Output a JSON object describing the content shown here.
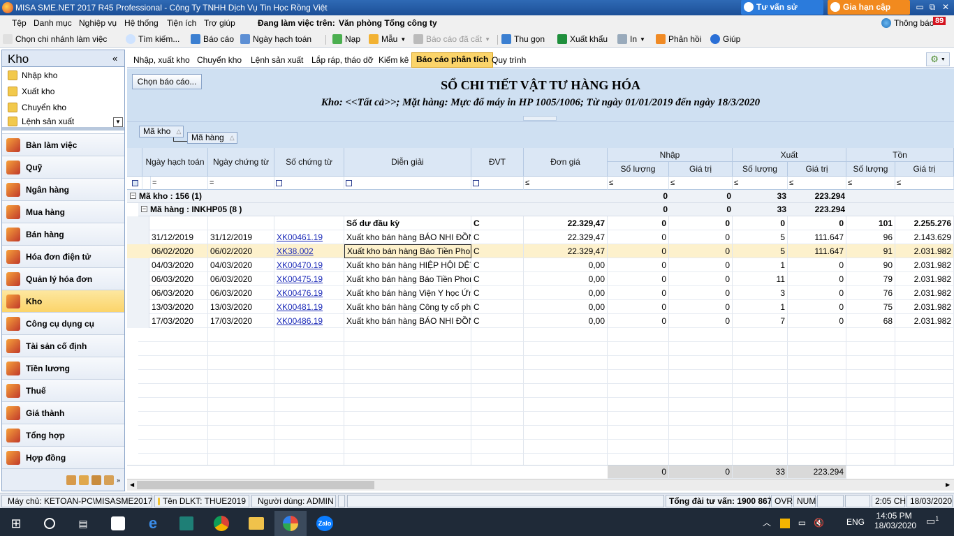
{
  "window": {
    "title": "MISA SME.NET 2017 R45 Professional - Công Ty TNHH Dịch Vụ Tin Học Rồng Việt",
    "advice": "Tư vấn sử dụng",
    "renew": "Gia hạn cập nhật",
    "minimize": "▭",
    "restore": "⧉",
    "close": "✕"
  },
  "menu": {
    "items": [
      "Tệp",
      "Danh mục",
      "Nghiệp vụ",
      "Hệ thống",
      "Tiện ích",
      "Trợ giúp"
    ],
    "working_label": "Đang làm việc trên:",
    "working_value": "Văn phòng Tổng công ty",
    "notice_label": "Thông báo",
    "notice_count": "89"
  },
  "toolbar": {
    "items": [
      "Chọn chi nhánh làm việc",
      "Tìm kiếm...",
      "Báo cáo",
      "Ngày hạch toán",
      "Nạp",
      "Mẫu",
      "Báo cáo đã cất",
      "Thu gọn",
      "Xuất khẩu",
      "In",
      "Phản hồi",
      "Giúp"
    ]
  },
  "sidebar": {
    "title": "Kho",
    "collapse": "«",
    "links": [
      "Nhập kho",
      "Xuất kho",
      "Chuyển kho",
      "Lệnh sản xuất"
    ],
    "modules": [
      "Bàn làm việc",
      "Quỹ",
      "Ngân hàng",
      "Mua hàng",
      "Bán hàng",
      "Hóa đơn điện tử",
      "Quản lý hóa đơn",
      "Kho",
      "Công cụ dụng cụ",
      "Tài sản cố định",
      "Tiền lương",
      "Thuế",
      "Giá thành",
      "Tổng hợp",
      "Hợp đồng"
    ]
  },
  "tabs": [
    "Nhập, xuất kho",
    "Chuyển kho",
    "Lệnh sản xuất",
    "Lắp ráp, tháo dỡ",
    "Kiểm kê",
    "Báo cáo phân tích",
    "Quy trình"
  ],
  "report": {
    "choose": "Chọn báo cáo...",
    "title": "SỔ CHI TIẾT VẬT TƯ HÀNG HÓA",
    "subtitle": "Kho: <<Tất cả>>; Mặt hàng: Mực đổ máy in HP 1005/1006; Từ ngày 01/01/2019 đến ngày 18/3/2020",
    "group_chips": [
      "Mã kho",
      "Mã hàng"
    ]
  },
  "grid": {
    "headers": [
      "Ngày hạch toán",
      "Ngày chứng từ",
      "Số chứng từ",
      "Diễn giải",
      "ĐVT",
      "Đơn giá"
    ],
    "groups": [
      "Nhập",
      "Xuất",
      "Tồn"
    ],
    "sub": [
      "Số lượng",
      "Giá trị",
      "Số lượng",
      "Giá trị",
      "Số lượng",
      "Giá trị"
    ],
    "filters": [
      "=",
      "=",
      "□",
      "□",
      "□",
      "≤",
      "≤",
      "≤",
      "≤",
      "≤",
      "≤",
      "≤"
    ],
    "group1": {
      "label": "Mã kho : 156 (1)",
      "vals": [
        "0",
        "0",
        "33",
        "223.294"
      ]
    },
    "group2": {
      "label": "Mã hàng : INKHP05 (8 )",
      "vals": [
        "0",
        "0",
        "33",
        "223.294"
      ]
    },
    "rows": [
      [
        "",
        "",
        "",
        "Số dư đầu kỳ",
        "C",
        "22.329,47",
        "0",
        "0",
        "0",
        "0",
        "101",
        "2.255.276"
      ],
      [
        "31/12/2019",
        "31/12/2019",
        "XK00461.19",
        "Xuất kho bán hàng BÁO NHI ĐỒN",
        "C",
        "22.329,47",
        "0",
        "0",
        "5",
        "111.647",
        "96",
        "2.143.629"
      ],
      [
        "06/02/2020",
        "06/02/2020",
        "XK38.002",
        "Xuất kho bán hàng Báo Tiền Phon",
        "C",
        "22.329,47",
        "0",
        "0",
        "5",
        "111.647",
        "91",
        "2.031.982"
      ],
      [
        "04/03/2020",
        "04/03/2020",
        "XK00470.19",
        "Xuất kho bán hàng HIỆP HỘI DỆT",
        "C",
        "0,00",
        "0",
        "0",
        "1",
        "0",
        "90",
        "2.031.982"
      ],
      [
        "06/03/2020",
        "06/03/2020",
        "XK00475.19",
        "Xuất kho bán hàng Báo Tiền Phon",
        "C",
        "0,00",
        "0",
        "0",
        "11",
        "0",
        "79",
        "2.031.982"
      ],
      [
        "06/03/2020",
        "06/03/2020",
        "XK00476.19",
        "Xuất kho bán hàng Viện Y học Ứn",
        "C",
        "0,00",
        "0",
        "0",
        "3",
        "0",
        "76",
        "2.031.982"
      ],
      [
        "13/03/2020",
        "13/03/2020",
        "XK00481.19",
        "Xuất kho bán hàng Công ty cổ ph",
        "C",
        "0,00",
        "0",
        "0",
        "1",
        "0",
        "75",
        "2.031.982"
      ],
      [
        "17/03/2020",
        "17/03/2020",
        "XK00486.19",
        "Xuất kho bán hàng BÁO NHI ĐỒN",
        "C",
        "0,00",
        "0",
        "0",
        "7",
        "0",
        "68",
        "2.031.982"
      ]
    ],
    "totals": [
      "0",
      "0",
      "33",
      "223.294"
    ]
  },
  "status": {
    "server": "Máy chủ: KETOAN-PC\\MISASME2017",
    "db": "Tên DLKT: THUE2019",
    "user": "Người dùng: ADMIN",
    "hotline": "Tổng đài tư vấn: 1900 8677",
    "ovr": "OVR",
    "num": "NUM",
    "time": "2:05 CH",
    "date": "18/03/2020"
  },
  "taskbar": {
    "lang": "ENG",
    "time": "14:05 PM",
    "date": "18/03/2020",
    "notif": "1",
    "zalo": "Zalo"
  }
}
